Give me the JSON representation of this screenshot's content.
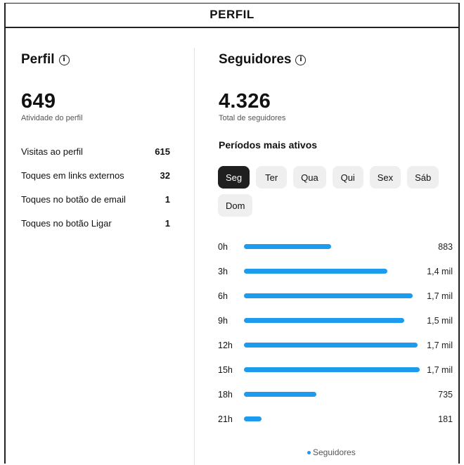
{
  "header": {
    "title": "PERFIL"
  },
  "profile": {
    "title": "Perfil",
    "value": "649",
    "value_label": "Atividade do perfil",
    "metrics": [
      {
        "label": "Visitas ao perfil",
        "value": "615"
      },
      {
        "label": "Toques em links externos",
        "value": "32"
      },
      {
        "label": "Toques no botão de email",
        "value": "1"
      },
      {
        "label": "Toques no botão Ligar",
        "value": "1"
      }
    ]
  },
  "followers": {
    "title": "Seguidores",
    "value": "4.326",
    "value_label": "Total de seguidores",
    "active_title": "Períodos mais ativos",
    "days": [
      "Seg",
      "Ter",
      "Qua",
      "Qui",
      "Sex",
      "Sáb",
      "Dom"
    ],
    "selected_day": "Seg",
    "legend": "Seguidores"
  },
  "chart_data": {
    "type": "bar",
    "orientation": "horizontal",
    "categories": [
      "0h",
      "3h",
      "6h",
      "9h",
      "12h",
      "15h",
      "18h",
      "21h"
    ],
    "series": [
      {
        "name": "Seguidores",
        "values": [
          883,
          1450,
          1710,
          1620,
          1760,
          1780,
          735,
          181
        ]
      }
    ],
    "value_labels": [
      "883",
      "1,4 mil",
      "1,7 mil",
      "1,5 mil",
      "1,7 mil",
      "1,7 mil",
      "735",
      "181"
    ],
    "xlim": [
      0,
      1780
    ],
    "grid": false,
    "legend": "bottom",
    "colors": {
      "bar": "#1c9bef"
    }
  }
}
